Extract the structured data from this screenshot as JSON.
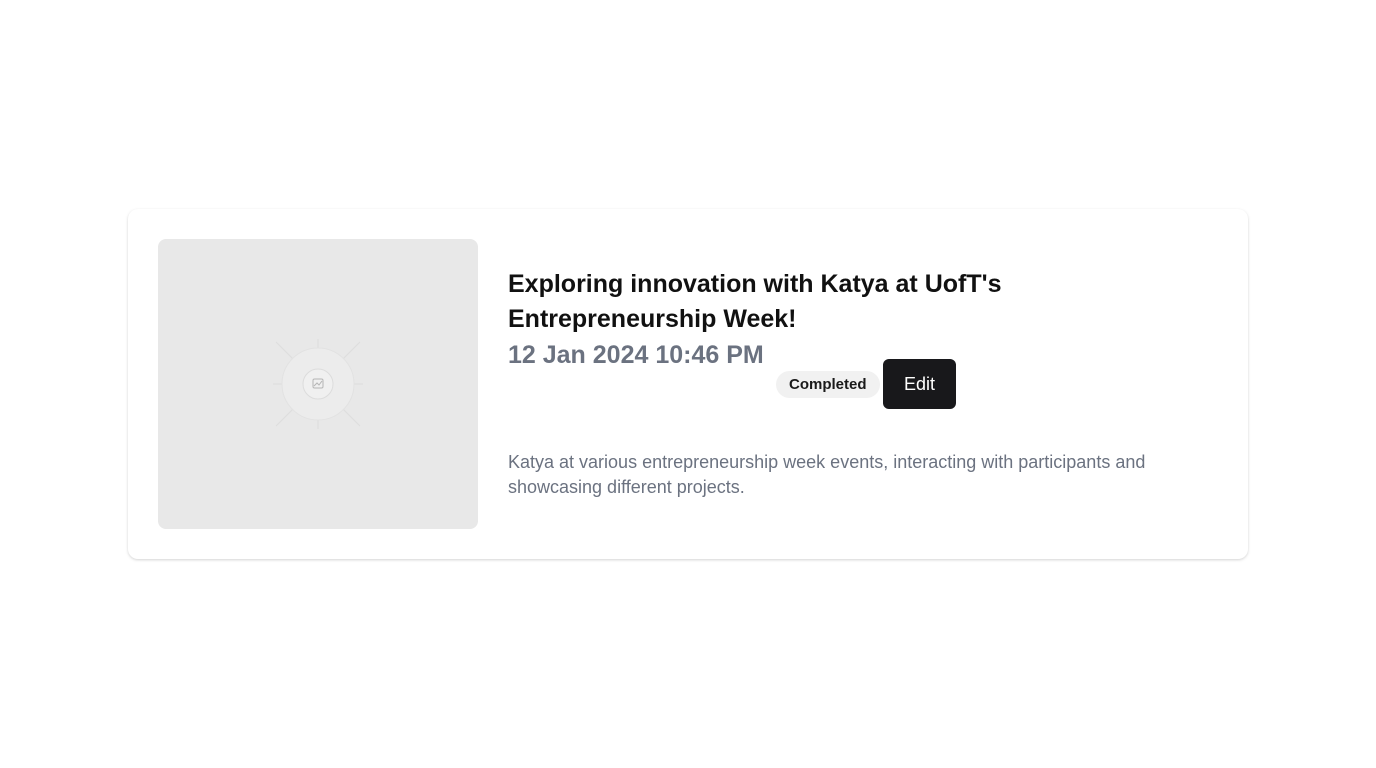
{
  "event": {
    "title": "Exploring innovation with Katya at UofT's Entrepreneurship Week!",
    "datetime": "12 Jan 2024 10:46 PM",
    "status": "Completed",
    "edit_label": "Edit",
    "description": "Katya at various entrepreneurship week events, interacting with participants and showcasing different projects.",
    "image_icon": "image-placeholder-icon"
  },
  "colors": {
    "primary_button": "#18181b",
    "muted_text": "#6b7280",
    "badge_bg": "#f1f1f1",
    "placeholder_bg": "#e8e8e8"
  }
}
